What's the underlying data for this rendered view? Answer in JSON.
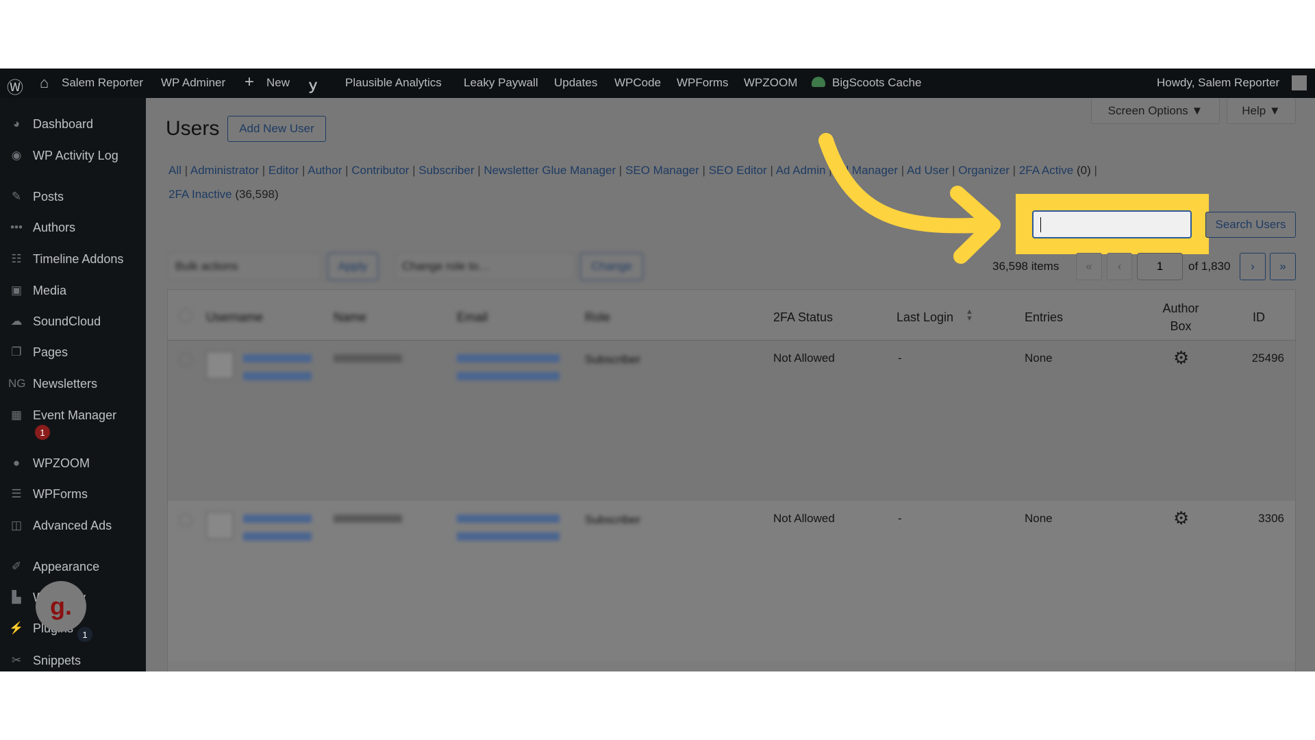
{
  "adminbar": {
    "site": "Salem Reporter",
    "items": [
      "WP Adminer",
      "New",
      "Plausible Analytics",
      "Leaky Paywall",
      "Updates",
      "WPCode",
      "WPForms",
      "WPZOOM",
      "BigScoots Cache"
    ],
    "howdy": "Howdy, Salem Reporter"
  },
  "sidebar": {
    "items": [
      {
        "label": "Dashboard",
        "icon": "dashboard-icon"
      },
      {
        "label": "WP Activity Log",
        "icon": "activity-log-icon"
      },
      {
        "label": "Posts",
        "icon": "pin-icon"
      },
      {
        "label": "Authors",
        "icon": "dots-icon"
      },
      {
        "label": "Timeline Addons",
        "icon": "timeline-icon"
      },
      {
        "label": "Media",
        "icon": "media-icon"
      },
      {
        "label": "SoundCloud",
        "icon": "cloud-icon"
      },
      {
        "label": "Pages",
        "icon": "pages-icon"
      },
      {
        "label": "Newsletters",
        "icon": "newsletter-icon"
      },
      {
        "label": "Event Manager",
        "icon": "calendar-icon",
        "badge": "1"
      },
      {
        "label": "WPZOOM",
        "icon": "wpzoom-icon"
      },
      {
        "label": "WPForms",
        "icon": "forms-icon"
      },
      {
        "label": "Advanced Ads",
        "icon": "ads-icon"
      },
      {
        "label": "Appearance",
        "icon": "brush-icon"
      },
      {
        "label": "W         ry",
        "icon": "chart-icon"
      },
      {
        "label": "Plugins",
        "icon": "plugin-icon",
        "badge": "1"
      },
      {
        "label": "Snippets",
        "icon": "scissors-icon"
      }
    ],
    "avatar_letter": "g."
  },
  "page": {
    "title": "Users",
    "add_new": "Add New User",
    "screen_options": "Screen Options ▼",
    "help": "Help ▼",
    "filters": [
      {
        "label": "All"
      },
      {
        "label": "Administrator"
      },
      {
        "label": "Editor"
      },
      {
        "label": "Author"
      },
      {
        "label": "Contributor"
      },
      {
        "label": "Subscriber"
      },
      {
        "label": "Newsletter Glue Manager"
      },
      {
        "label": "SEO Manager"
      },
      {
        "label": "SEO Editor"
      },
      {
        "label": "Ad Admin"
      },
      {
        "label": "Ad Manager"
      },
      {
        "label": "Ad User"
      },
      {
        "label": "Organizer"
      },
      {
        "label": "2FA Active",
        "count": "(0)"
      }
    ],
    "filter2": {
      "label": "2FA Inactive",
      "count": "(36,598)"
    },
    "search_value": "",
    "search_button": "Search Users",
    "bulk_actions": "Bulk actions",
    "apply": "Apply",
    "change_role": "Change role to…",
    "change": "Change",
    "items": "36,598 items",
    "first": "«",
    "prev": "‹",
    "current_page": "1",
    "of_pages": "of 1,830",
    "next": "›",
    "last": "»"
  },
  "table": {
    "headers": [
      "Username",
      "Name",
      "Email",
      "Role",
      "2FA Status",
      "Last Login",
      "Entries",
      "Author Box",
      "ID"
    ],
    "rows": [
      {
        "role": "Subscriber",
        "status": "Not Allowed",
        "last_login": "-",
        "entries": "None",
        "id": "25496"
      },
      {
        "role": "Subscriber",
        "status": "Not Allowed",
        "last_login": "-",
        "entries": "None",
        "id": "3306"
      }
    ]
  },
  "colors": {
    "highlight": "#fdd33f",
    "adminbar": "#0e1114",
    "link": "#1e3b63"
  }
}
